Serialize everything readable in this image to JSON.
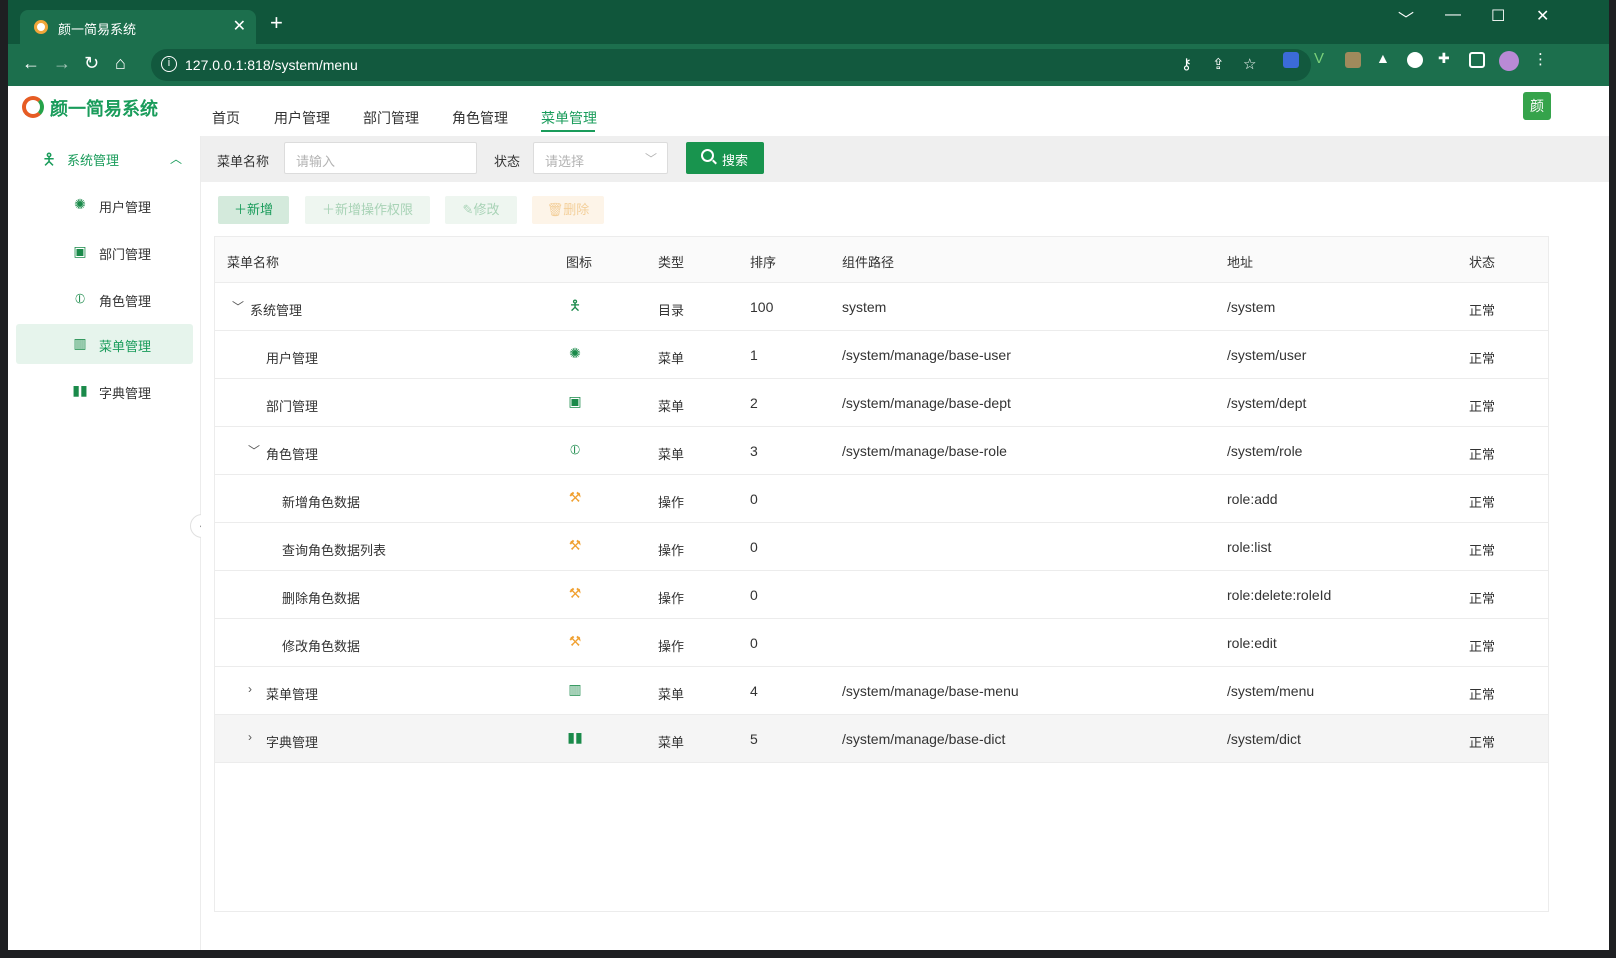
{
  "browser": {
    "tab_title": "颜一简易系统",
    "close_glyph": "✕",
    "newtab_glyph": "+",
    "url": "127.0.0.1:818/system/menu",
    "controls": [
      "﹀",
      "—",
      "☐",
      "✕"
    ]
  },
  "app": {
    "title": "颜一简易系统",
    "nav": [
      "首页",
      "用户管理",
      "部门管理",
      "角色管理",
      "菜单管理"
    ],
    "active_nav": "菜单管理",
    "avatar": "颜",
    "brand_color": "#1a9c5b"
  },
  "sidebar": {
    "group_label": "系统管理",
    "items": [
      {
        "label": "用户管理",
        "icon": "aperture-icon"
      },
      {
        "label": "部门管理",
        "icon": "archive-icon"
      },
      {
        "label": "角色管理",
        "icon": "paperclip-icon"
      },
      {
        "label": "菜单管理",
        "icon": "bar-chart-icon"
      },
      {
        "label": "字典管理",
        "icon": "book-icon"
      }
    ],
    "active_item": "菜单管理"
  },
  "search": {
    "name_label": "菜单名称",
    "name_placeholder": "请输入",
    "status_label": "状态",
    "status_placeholder": "请选择",
    "search_button": "搜索"
  },
  "actions": {
    "add": "＋新增",
    "add_permission": "＋新增操作权限",
    "edit": "修改",
    "delete": "删除"
  },
  "table": {
    "headers": [
      "菜单名称",
      "图标",
      "类型",
      "排序",
      "组件路径",
      "地址",
      "状态"
    ],
    "rows": [
      {
        "name": "系统管理",
        "icon": "person-icon",
        "type": "目录",
        "order": "100",
        "component": "system",
        "path": "/system",
        "status": "正常",
        "caret": "﹀"
      },
      {
        "name": "用户管理",
        "icon": "aperture-icon",
        "type": "菜单",
        "order": "1",
        "component": "/system/manage/base-user",
        "path": "/system/user",
        "status": "正常",
        "caret": ""
      },
      {
        "name": "部门管理",
        "icon": "archive-icon",
        "type": "菜单",
        "order": "2",
        "component": "/system/manage/base-dept",
        "path": "/system/dept",
        "status": "正常",
        "caret": ""
      },
      {
        "name": "角色管理",
        "icon": "paperclip-icon",
        "type": "菜单",
        "order": "3",
        "component": "/system/manage/base-role",
        "path": "/system/role",
        "status": "正常",
        "caret": "﹀"
      },
      {
        "name": "新增角色数据",
        "icon": "tools-icon",
        "type": "操作",
        "order": "0",
        "component": "",
        "path": "role:add",
        "status": "正常",
        "caret": ""
      },
      {
        "name": "查询角色数据列表",
        "icon": "tools-icon",
        "type": "操作",
        "order": "0",
        "component": "",
        "path": "role:list",
        "status": "正常",
        "caret": ""
      },
      {
        "name": "删除角色数据",
        "icon": "tools-icon",
        "type": "操作",
        "order": "0",
        "component": "",
        "path": "role:delete:roleId",
        "status": "正常",
        "caret": ""
      },
      {
        "name": "修改角色数据",
        "icon": "tools-icon",
        "type": "操作",
        "order": "0",
        "component": "",
        "path": "role:edit",
        "status": "正常",
        "caret": ""
      },
      {
        "name": "菜单管理",
        "icon": "bar-chart-icon",
        "type": "菜单",
        "order": "4",
        "component": "/system/manage/base-menu",
        "path": "/system/menu",
        "status": "正常",
        "caret": "›"
      },
      {
        "name": "字典管理",
        "icon": "book-icon",
        "type": "菜单",
        "order": "5",
        "component": "/system/manage/base-dict",
        "path": "/system/dict",
        "status": "正常",
        "caret": "›"
      }
    ]
  }
}
